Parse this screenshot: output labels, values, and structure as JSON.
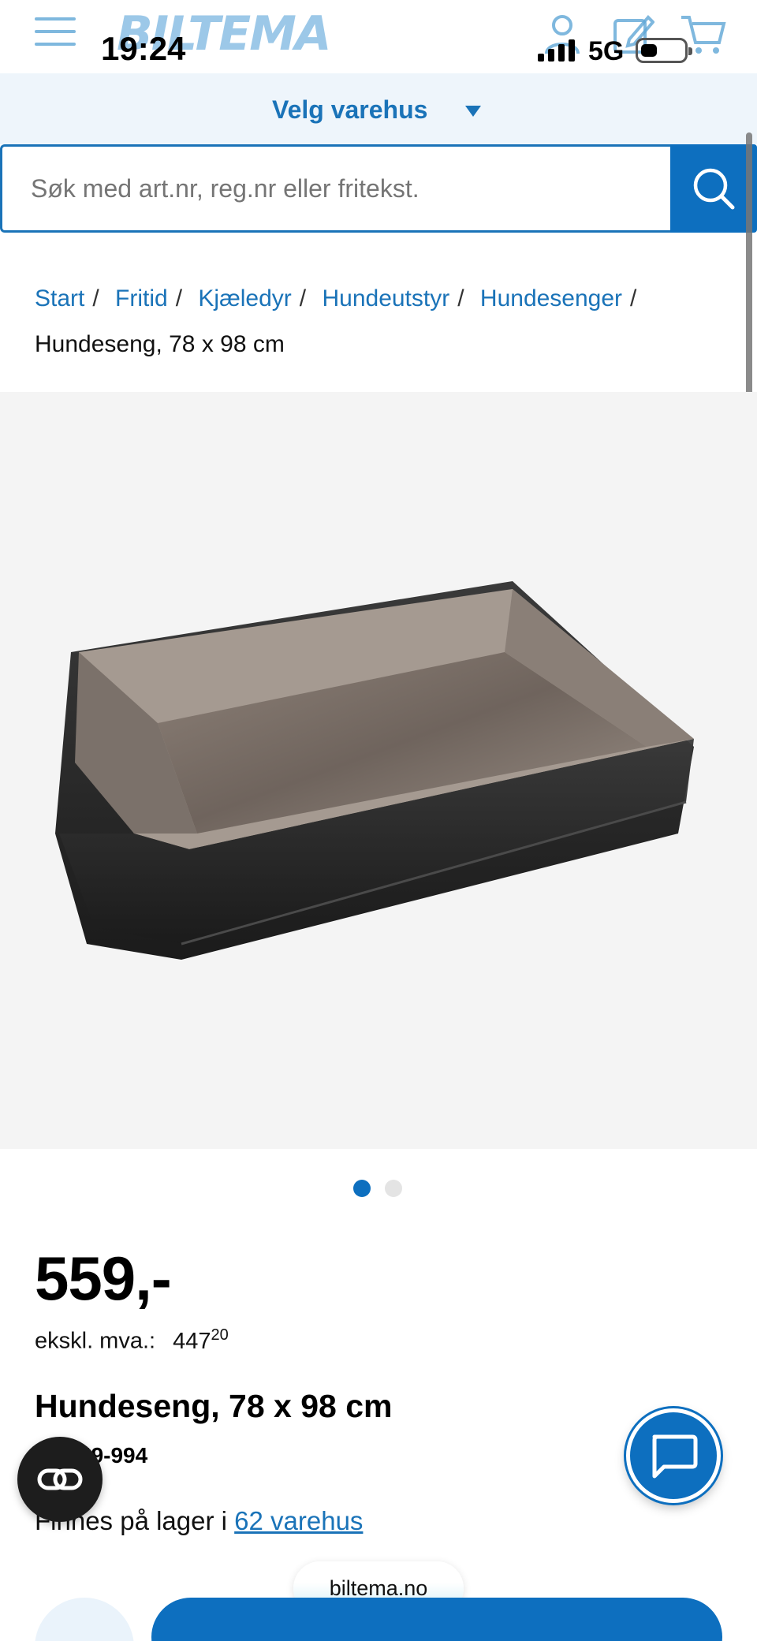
{
  "status_bar": {
    "time": "19:24",
    "network": "5G"
  },
  "header": {
    "logo": "BILTEMA",
    "icons": [
      "menu-icon",
      "user-icon",
      "edit-icon",
      "cart-icon"
    ]
  },
  "store_selector": {
    "label": "Velg varehus"
  },
  "search": {
    "placeholder": "Søk med art.nr, reg.nr eller fritekst."
  },
  "breadcrumb": {
    "items": [
      "Start",
      "Fritid",
      "Kjæledyr",
      "Hundeutstyr",
      "Hundesenger"
    ],
    "current": "Hundeseng, 78 x 98 cm"
  },
  "carousel": {
    "total": 2,
    "active": 1
  },
  "product": {
    "price": "559,-",
    "vat_label": "ekskl. mva.:",
    "vat_amount": "447",
    "vat_cents": "20",
    "title": "Hundeseng, 78 x 98 cm",
    "artno": "Art. 49-994",
    "stock_prefix": "Finnes på lager i",
    "stock_link": "62 varehus"
  },
  "floating": {
    "url": "biltema.no"
  },
  "colors": {
    "brand_blue": "#0d6fbf",
    "link_blue": "#1a73b8",
    "store_bar_bg": "#eef5fb"
  }
}
